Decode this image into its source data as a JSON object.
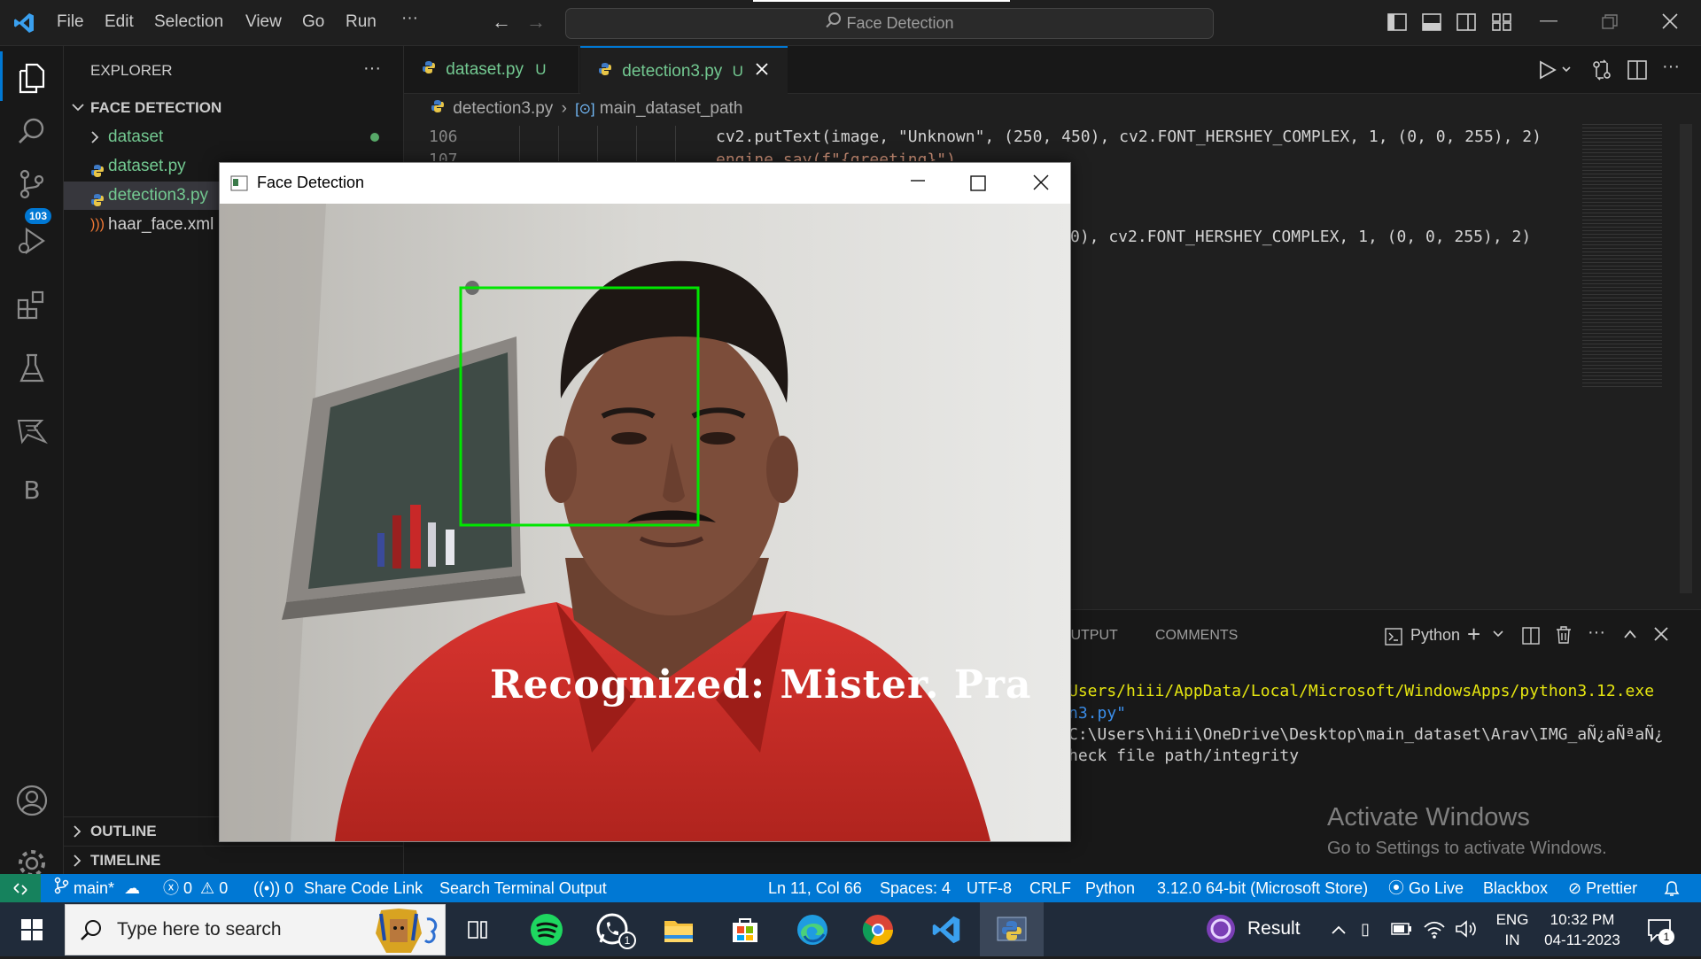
{
  "menu": [
    "File",
    "Edit",
    "Selection",
    "View",
    "Go",
    "Run"
  ],
  "search_center": "Face Detection",
  "activity": {
    "scm_badge": "103",
    "letter_b": "B"
  },
  "explorer": {
    "title": "EXPLORER",
    "more": "···",
    "folder": "FACE DETECTION",
    "items": [
      {
        "name": "dataset",
        "type": "folder"
      },
      {
        "name": "dataset.py",
        "type": "python"
      },
      {
        "name": "detection3.py",
        "type": "python"
      },
      {
        "name": "haar_face.xml",
        "type": "xml"
      }
    ],
    "outline": "OUTLINE",
    "timeline": "TIMELINE"
  },
  "tabs": [
    {
      "label": "dataset.py",
      "status": "U"
    },
    {
      "label": "detection3.py",
      "status": "U"
    }
  ],
  "breadcrumb": {
    "file": "detection3.py",
    "symbol": "main_dataset_path"
  },
  "code": {
    "line106_num": "106",
    "line107_num": "107",
    "line106": "cv2.putText(image, \"Unknown\", (250, 450), cv2.FONT_HERSHEY_COMPLEX, 1, (0, 0, 255), 2)",
    "line107": "engine.say(f\"{greeting}\")",
    "line109": "0), cv2.FONT_HERSHEY_COMPLEX, 1, (0, 0, 255), 2)"
  },
  "panel": {
    "tabs": [
      "OUTPUT",
      "COMMENTS"
    ],
    "terminal_name": "Python",
    "lines": [
      "Users/hiii/AppData/Local/Microsoft/WindowsApps/python3.12.exe",
      "n3.py\"",
      "C:\\Users\\hiii\\OneDrive\\Desktop\\main_dataset\\Arav\\IMG_aÑ¿aÑªaÑ¿",
      "heck file path/integrity"
    ]
  },
  "activate": {
    "title": "Activate Windows",
    "subtitle": "Go to Settings to activate Windows."
  },
  "statusbar": {
    "branch": "main*",
    "errors": "0",
    "warnings": "0",
    "ports": "0",
    "share": "Share Code Link",
    "search_terminal": "Search Terminal Output",
    "position": "Ln 11, Col 66",
    "spaces": "Spaces: 4",
    "encoding": "UTF-8",
    "eol": "CRLF",
    "language": "Python",
    "interpreter": "3.12.0 64-bit (Microsoft Store)",
    "golive": "Go Live",
    "blackbox": "Blackbox",
    "prettier": "Prettier"
  },
  "fd_window": {
    "title": "Face Detection",
    "overlay_text": "Recognized: Mister. Pra"
  },
  "taskbar": {
    "search_placeholder": "Type here to search",
    "result_label": "Result",
    "lang_top": "ENG",
    "lang_bottom": "IN",
    "time": "10:32 PM",
    "date": "04-11-2023",
    "notif_count": "1",
    "whatsapp_badge": "1"
  }
}
